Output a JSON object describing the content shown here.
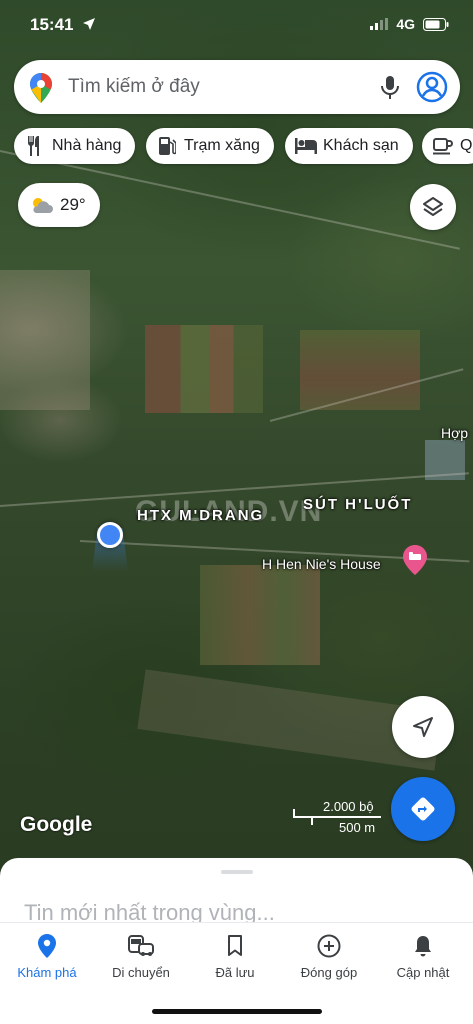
{
  "status_bar": {
    "time": "15:41",
    "network": "4G"
  },
  "search": {
    "placeholder": "Tìm kiếm ở đây"
  },
  "chips": [
    {
      "label": "Nhà hàng",
      "icon": "restaurant-icon"
    },
    {
      "label": "Trạm xăng",
      "icon": "gas-station-icon"
    },
    {
      "label": "Khách sạn",
      "icon": "hotel-icon"
    },
    {
      "label": "Q",
      "icon": "coffee-icon"
    }
  ],
  "weather": {
    "temp": "29°",
    "icon": "partly-cloudy-icon"
  },
  "map_labels": {
    "htx": "HTX M'DRANG",
    "sut": "SÚT H'LUỐT",
    "poi": "H Hen Nie's House",
    "edge": "Hợp"
  },
  "watermark": "GULAND.VN",
  "scale": {
    "imperial": "2.000 bộ",
    "metric": "500 m"
  },
  "brand": "Google",
  "sheet": {
    "title": "Tin mới nhất trong vùng..."
  },
  "nav": [
    {
      "label": "Khám phá",
      "icon": "explore-pin-icon",
      "active": true
    },
    {
      "label": "Di chuyển",
      "icon": "commute-icon",
      "active": false
    },
    {
      "label": "Đã lưu",
      "icon": "bookmark-icon",
      "active": false
    },
    {
      "label": "Đóng góp",
      "icon": "add-circle-icon",
      "active": false
    },
    {
      "label": "Cập nhật",
      "icon": "bell-icon",
      "active": false
    }
  ],
  "colors": {
    "accent": "#1a73e8",
    "poi": "#e8568d",
    "location_dot": "#4285f4"
  }
}
